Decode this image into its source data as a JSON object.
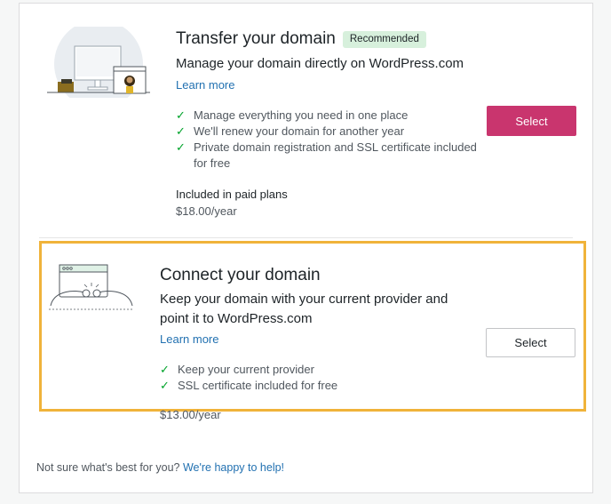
{
  "transfer": {
    "title": "Transfer your domain",
    "badge": "Recommended",
    "subtitle": "Manage your domain directly on WordPress.com",
    "learn_more": "Learn more",
    "features": [
      "Manage everything you need in one place",
      "We'll renew your domain for another year",
      "Private domain registration and SSL certificate included for free"
    ],
    "plan_label": "Included in paid plans",
    "price": "$18.00/year",
    "select_label": "Select"
  },
  "connect": {
    "title": "Connect your domain",
    "subtitle": "Keep your domain with your current provider and point it to WordPress.com",
    "learn_more": "Learn more",
    "features": [
      "Keep your current provider",
      "SSL certificate included for free"
    ],
    "price": "$13.00/year",
    "select_label": "Select"
  },
  "help": {
    "text": "Not sure what's best for you?",
    "link": "We're happy to help!"
  },
  "colors": {
    "accent_primary": "#c9356e",
    "highlight_border": "#f0b33a",
    "check": "#00a32a",
    "link": "#2271b1",
    "badge_bg": "#d7f0dc"
  }
}
